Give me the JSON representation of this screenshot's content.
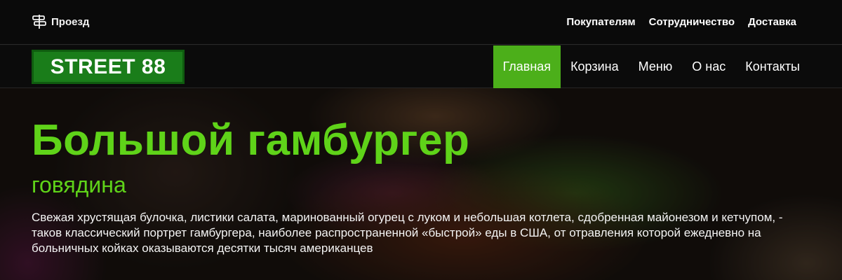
{
  "topbar": {
    "route_label": "Проезд",
    "links": [
      "Покупателям",
      "Сотрудничество",
      "Доставка"
    ]
  },
  "navbar": {
    "logo": "STREET 88",
    "menu": [
      {
        "label": "Главная",
        "active": true
      },
      {
        "label": "Корзина",
        "active": false
      },
      {
        "label": "Меню",
        "active": false
      },
      {
        "label": "О нас",
        "active": false
      },
      {
        "label": "Контакты",
        "active": false
      }
    ]
  },
  "hero": {
    "title": "Большой гамбургер",
    "subtitle": "говядина",
    "text": "Свежая хрустящая булочка, листики салата, маринованный огурец с луком и небольшая котлета, сдобренная майонезом и кетчупом, - таков классический портрет гамбургера, наиболее распространенной «быстрой» еды в США, от отравления которой ежедневно на больничных койках оказываются десятки тысяч американцев"
  },
  "colors": {
    "accent": "#4caf1a",
    "title_green": "#5fd319",
    "logo_green": "#1a7d1a"
  },
  "icons": {
    "route": "signpost-icon"
  }
}
